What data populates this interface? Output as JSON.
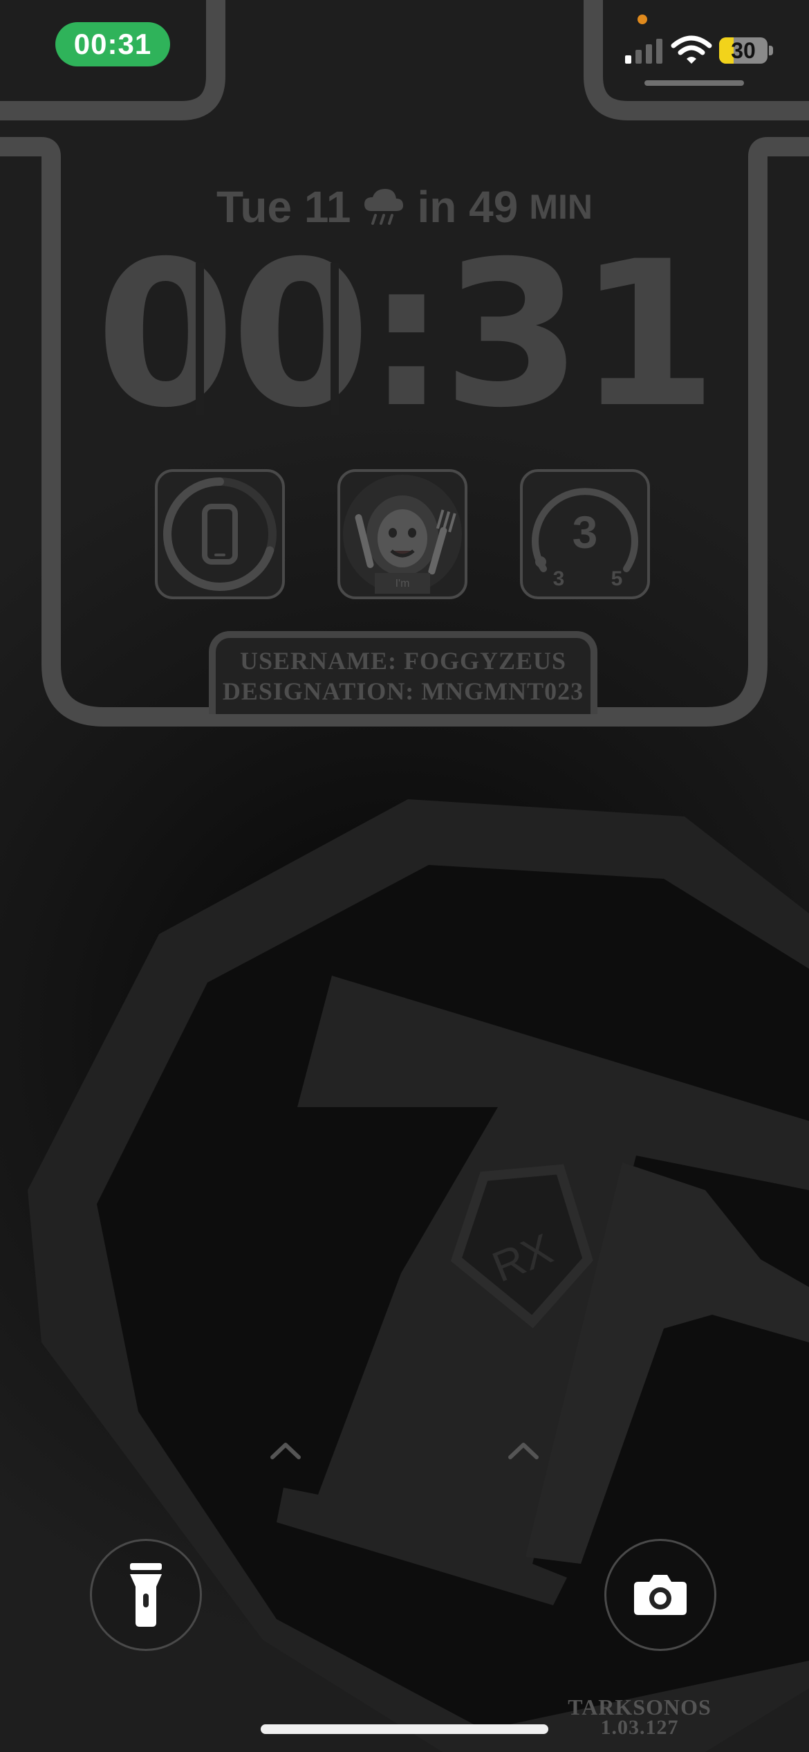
{
  "status_bar": {
    "time": "00:31",
    "battery_level": "30",
    "battery_fraction": 0.3,
    "signal_bars_active": 1,
    "icons": [
      "camera-in-use-dot",
      "cellular-signal-icon",
      "wifi-icon",
      "battery-icon"
    ]
  },
  "lock_screen": {
    "date_label": "Tue 11",
    "weather_text": "in 49",
    "weather_unit": "MIN",
    "weather_icon": "rain-cloud-icon",
    "clock": "00:31"
  },
  "widgets": [
    {
      "name": "device-battery-widget",
      "icon": "phone-icon",
      "ring_fraction": 0.3
    },
    {
      "name": "memoji-widget",
      "icon": "memoji-avatar",
      "caption": "I'm"
    },
    {
      "name": "gauge-widget",
      "value": "3",
      "min_label": "3",
      "max_label": "5"
    }
  ],
  "plate": {
    "username_line": "USERNAME: FOGGYZEUS",
    "designation_line": "DESIGNATION: MNGMNT023"
  },
  "wallpaper": {
    "emblem_text": "RX",
    "watermark_line1": "TARKSONOS",
    "watermark_line2": "1.03.127"
  },
  "controls": {
    "flashlight": "flashlight-icon",
    "camera": "camera-icon"
  },
  "colors": {
    "pill_green": "#2fb35a",
    "battery_yellow": "#f2d31b",
    "frame_gray": "#4a4a4a",
    "camera_dot": "#e08a1d"
  }
}
